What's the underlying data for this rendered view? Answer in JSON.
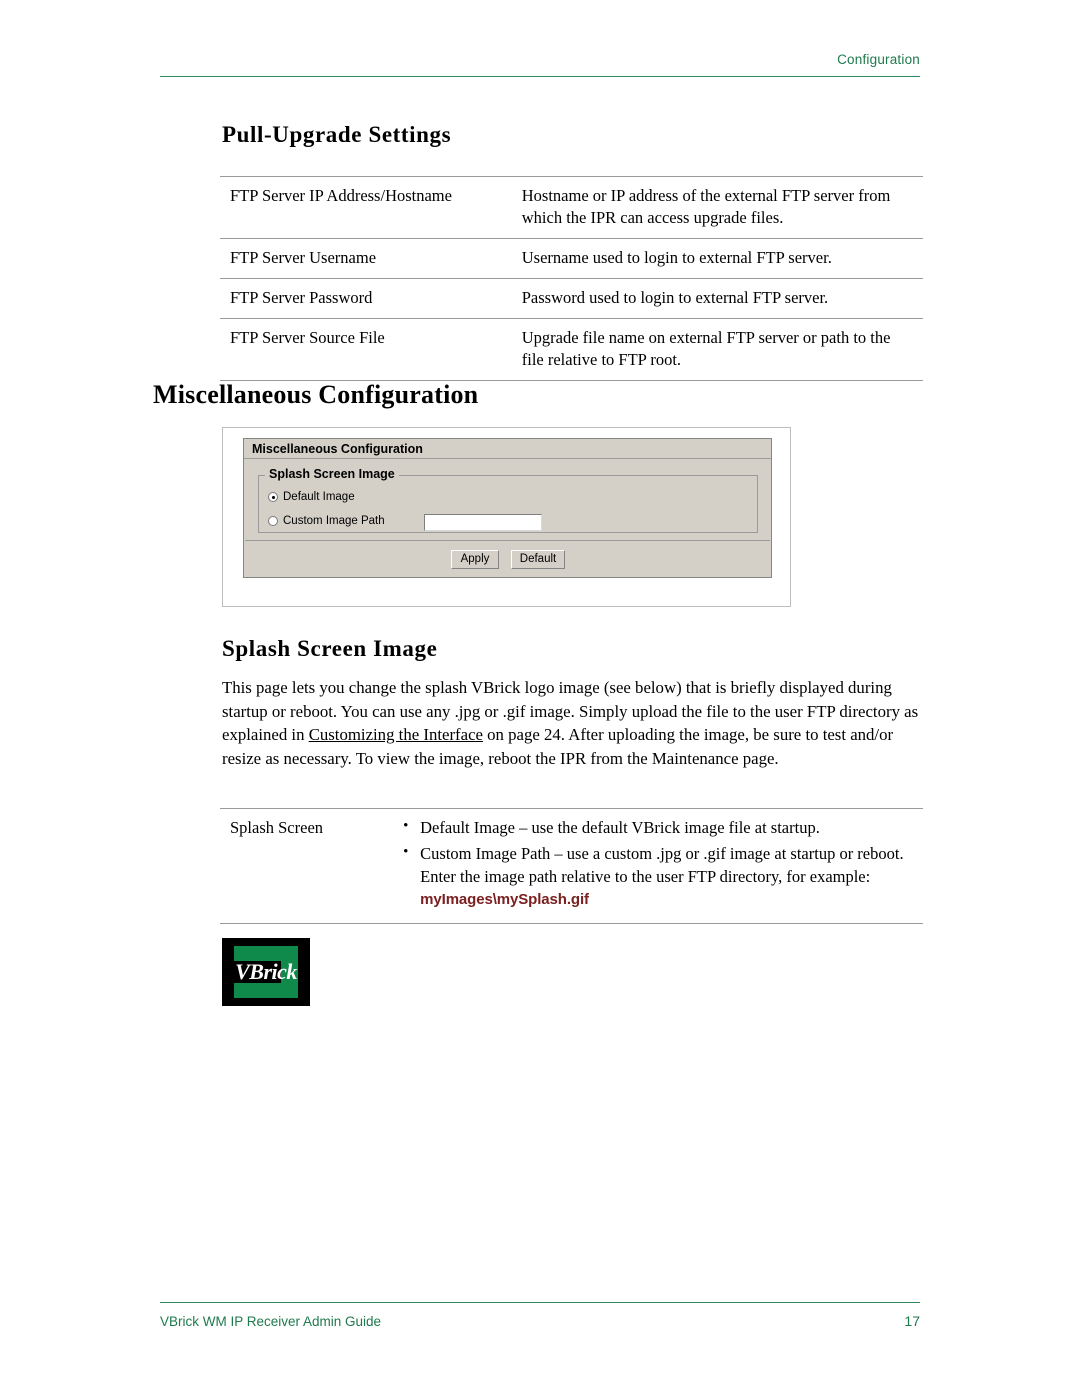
{
  "header": {
    "chapter": "Configuration"
  },
  "sections": {
    "pull_upgrade": {
      "heading": "Pull-Upgrade Settings",
      "rows": [
        {
          "label": "FTP Server IP Address/Hostname",
          "desc": "Hostname or IP address of the external FTP server from which the IPR can access upgrade files."
        },
        {
          "label": "FTP Server Username",
          "desc": "Username used to login to external FTP server."
        },
        {
          "label": "FTP Server Password",
          "desc": "Password used to login to external FTP server."
        },
        {
          "label": "FTP Server Source File",
          "desc": "Upgrade file name on external FTP server or path to the file relative to FTP root."
        }
      ]
    },
    "misc_config": {
      "heading": "Miscellaneous Configuration"
    },
    "splash": {
      "heading": "Splash Screen Image",
      "paragraph_1": "This page lets you change the splash VBrick logo image (see below) that is briefly displayed during startup or reboot. You can use any .jpg or .gif image. Simply upload the file to the user FTP directory as explained in ",
      "link_text": "Customizing the Interface",
      "paragraph_2": " on page 24. After uploading the image, be sure to test and/or resize as necessary. To view the image, reboot the IPR from the Maintenance page.",
      "table_label": "Splash Screen",
      "bullets": [
        "Default Image – use the default VBrick image file at startup.",
        "Custom Image Path – use a custom .jpg or .gif image at startup or reboot. Enter the image path relative to the user FTP directory, for example: "
      ],
      "example_path": "myImages\\mySplash.gif"
    }
  },
  "screenshot": {
    "window_title": "Miscellaneous Configuration",
    "group_legend": "Splash Screen Image",
    "radio_default": "Default Image",
    "radio_custom": "Custom Image Path",
    "custom_path_value": "",
    "buttons": {
      "apply": "Apply",
      "default": "Default"
    }
  },
  "logo": {
    "text": "VBrick"
  },
  "footer": {
    "guide": "VBrick WM IP Receiver Admin Guide",
    "page_number": "17"
  }
}
